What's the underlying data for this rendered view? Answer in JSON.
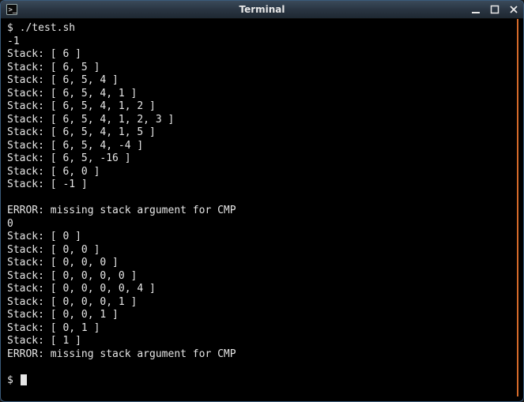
{
  "window": {
    "title": "Terminal",
    "icon_name": "terminal-icon"
  },
  "terminal": {
    "prompt": "$ ",
    "command": "./test.sh",
    "lines": [
      "-1",
      "Stack: [ 6 ]",
      "Stack: [ 6, 5 ]",
      "Stack: [ 6, 5, 4 ]",
      "Stack: [ 6, 5, 4, 1 ]",
      "Stack: [ 6, 5, 4, 1, 2 ]",
      "Stack: [ 6, 5, 4, 1, 2, 3 ]",
      "Stack: [ 6, 5, 4, 1, 5 ]",
      "Stack: [ 6, 5, 4, -4 ]",
      "Stack: [ 6, 5, -16 ]",
      "Stack: [ 6, 0 ]",
      "Stack: [ -1 ]",
      "",
      "ERROR: missing stack argument for CMP",
      "0",
      "Stack: [ 0 ]",
      "Stack: [ 0, 0 ]",
      "Stack: [ 0, 0, 0 ]",
      "Stack: [ 0, 0, 0, 0 ]",
      "Stack: [ 0, 0, 0, 0, 4 ]",
      "Stack: [ 0, 0, 0, 1 ]",
      "Stack: [ 0, 0, 1 ]",
      "Stack: [ 0, 1 ]",
      "Stack: [ 1 ]",
      "ERROR: missing stack argument for CMP",
      ""
    ],
    "final_prompt": "$ "
  }
}
